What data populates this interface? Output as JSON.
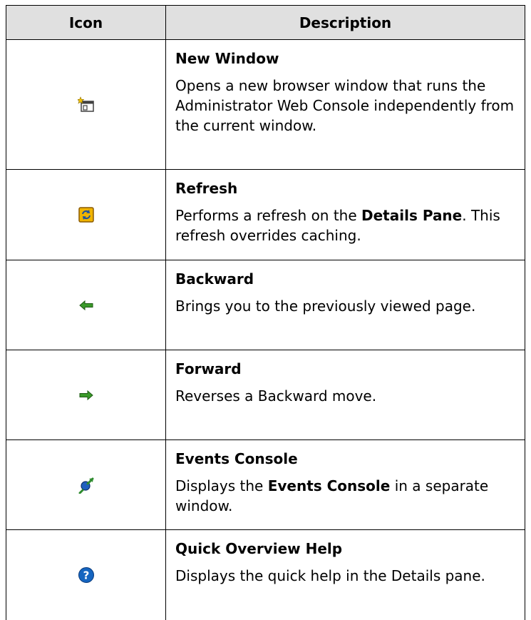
{
  "table": {
    "headers": {
      "icon": "Icon",
      "description": "Description"
    },
    "rows": [
      {
        "icon": "new-window-icon",
        "title": "New Window",
        "body": "Opens a new browser window that runs the Administrator Web Console independently from the current window."
      },
      {
        "icon": "refresh-icon",
        "title": "Refresh",
        "body_parts": [
          "Performs a refresh on the ",
          "Details Pane",
          ". This refresh overrides caching."
        ]
      },
      {
        "icon": "backward-arrow-icon",
        "title": "Backward",
        "body": "Brings you to the previously viewed page."
      },
      {
        "icon": "forward-arrow-icon",
        "title": "Forward",
        "body": "Reverses a Backward move."
      },
      {
        "icon": "events-console-icon",
        "title": "Events Console",
        "body_parts": [
          "Displays the ",
          "Events Console",
          " in a separate window."
        ]
      },
      {
        "icon": "help-question-icon",
        "title": "Quick Overview Help",
        "body": "Displays the quick help in the Details pane."
      }
    ]
  },
  "colors": {
    "header_background": "#e0e0e0",
    "border": "#000000",
    "arrow_green": "#3a9a2a",
    "help_blue": "#1565c0"
  }
}
